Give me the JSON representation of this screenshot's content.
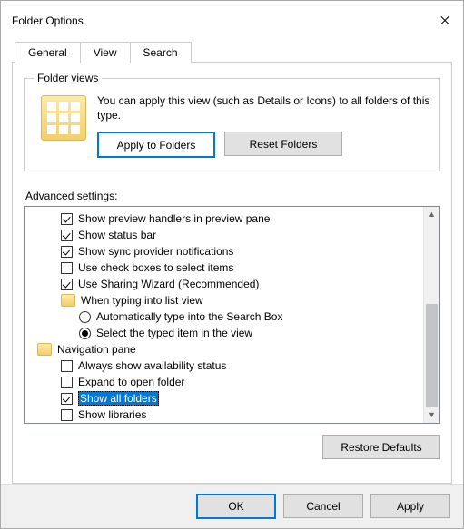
{
  "window": {
    "title": "Folder Options"
  },
  "tabs": {
    "general": "General",
    "view": "View",
    "search": "Search",
    "active": "view"
  },
  "folder_views": {
    "legend": "Folder views",
    "description": "You can apply this view (such as Details or Icons) to all folders of this type.",
    "apply_btn": "Apply to Folders",
    "reset_btn": "Reset Folders"
  },
  "advanced": {
    "label": "Advanced settings:",
    "items": [
      {
        "kind": "check",
        "level": 1,
        "checked": true,
        "label": "Show preview handlers in preview pane"
      },
      {
        "kind": "check",
        "level": 1,
        "checked": true,
        "label": "Show status bar"
      },
      {
        "kind": "check",
        "level": 1,
        "checked": true,
        "label": "Show sync provider notifications"
      },
      {
        "kind": "check",
        "level": 1,
        "checked": false,
        "label": "Use check boxes to select items"
      },
      {
        "kind": "check",
        "level": 1,
        "checked": true,
        "label": "Use Sharing Wizard (Recommended)"
      },
      {
        "kind": "folder",
        "level": 1,
        "label": "When typing into list view"
      },
      {
        "kind": "radio",
        "level": 2,
        "checked": false,
        "label": "Automatically type into the Search Box"
      },
      {
        "kind": "radio",
        "level": 2,
        "checked": true,
        "label": "Select the typed item in the view"
      },
      {
        "kind": "folder",
        "level": 0,
        "label": "Navigation pane"
      },
      {
        "kind": "check",
        "level": 1,
        "checked": false,
        "label": "Always show availability status"
      },
      {
        "kind": "check",
        "level": 1,
        "checked": false,
        "label": "Expand to open folder"
      },
      {
        "kind": "check",
        "level": 1,
        "checked": true,
        "label": "Show all folders",
        "selected": true
      },
      {
        "kind": "check",
        "level": 1,
        "checked": false,
        "label": "Show libraries"
      }
    ],
    "restore_btn": "Restore Defaults"
  },
  "buttons": {
    "ok": "OK",
    "cancel": "Cancel",
    "apply": "Apply"
  }
}
